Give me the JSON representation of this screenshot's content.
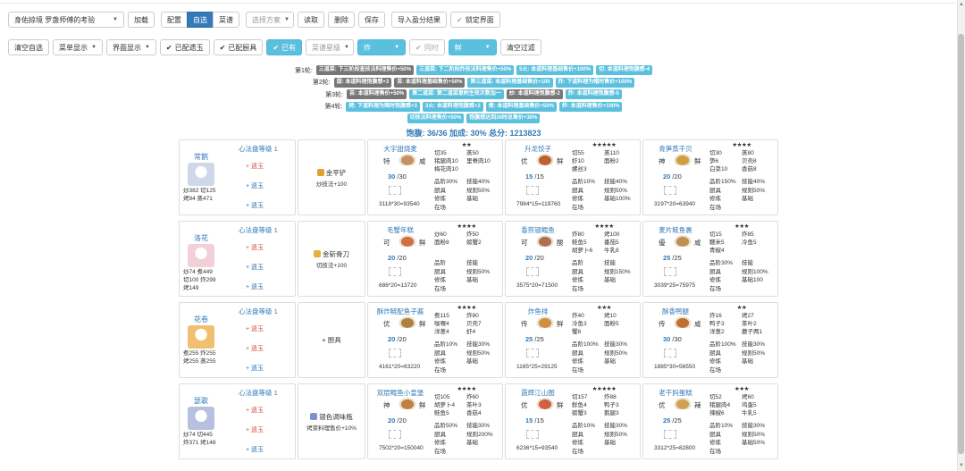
{
  "toolbar": {
    "rule_select": "身佑掠境 罗盏师傅的考验",
    "load": "加载",
    "config": "配置",
    "selfselect": "自选",
    "chef_select": "菜谱",
    "choose_plan": "选择方案",
    "read": "读取",
    "delete": "删除",
    "save": "保存",
    "import_result": "导入盈分结果",
    "lock_ui": "锁定界面"
  },
  "filterbar": {
    "clear_select": "清空自选",
    "menu_show": "菜单显示",
    "ui_show": "界面显示",
    "equipped_items": "已配遗玉",
    "equipped_tools": "已配厨具",
    "owned": "已有",
    "rarity_placeholder": "菜谱星级",
    "fry": "炸",
    "same_time": "同时",
    "fresh": "鲜",
    "clear_filter": "清空过滤"
  },
  "buffs": [
    {
      "label": "第1轮:",
      "tags": [
        {
          "text": "三道菜: 下三阶段查技法料理售价+50%",
          "c": "gray"
        },
        {
          "text": "三道菜: 下二阶段炸技法料理售价+50%",
          "c": "cyan"
        },
        {
          "text": "5火: 本道料理基础售价+100%",
          "c": "cyan"
        },
        {
          "text": "切: 本道料理饱腹感-4",
          "c": "cyan"
        }
      ]
    },
    {
      "label": "第2轮:",
      "tags": [
        {
          "text": "甜: 本道料理饱腹感+3",
          "c": "gray"
        },
        {
          "text": "苦: 本道料理基础售价+50%",
          "c": "gray"
        },
        {
          "text": "第三道菜: 本道料理基础售价+100",
          "c": "cyan"
        },
        {
          "text": "炸: 下道料理为帽时售价+100%",
          "c": "cyan"
        }
      ]
    },
    {
      "label": "第3轮:",
      "tags": [
        {
          "text": "苦: 本道料理售价+50%",
          "c": "gray"
        },
        {
          "text": "第二道菜: 第二道菜意附生效次数加一",
          "c": "cyan"
        },
        {
          "text": "炒: 本道料理饱腹感-2",
          "c": "gray"
        },
        {
          "text": "炸: 本道料理饱腹感-5",
          "c": "cyan"
        }
      ]
    },
    {
      "label": "第4轮:",
      "tags": [
        {
          "text": "烤: 下道料理为辣时饱腹感+3",
          "c": "cyan"
        },
        {
          "text": "3火: 本道料理饱腹感+2",
          "c": "cyan"
        },
        {
          "text": "煮: 本道料理基础售价+50%",
          "c": "cyan"
        },
        {
          "text": "炸: 本道料理售价+100%",
          "c": "cyan"
        }
      ]
    },
    {
      "label": "",
      "tags": [
        {
          "text": "切技法料理售价+50%",
          "c": "cyan"
        },
        {
          "text": "饱腹感达到36时总售价+30%",
          "c": "cyan"
        }
      ]
    }
  ],
  "summary": "饱腹: 36/36 加成: 30% 总分: 1213823",
  "rows": [
    {
      "chef": {
        "name": "常鹅",
        "level": "心法盘等级 1",
        "stats": [
          "炒382 切125",
          "烤94  蒸471"
        ],
        "av": "#cfd8e8",
        "axes": [
          {
            "t": "+ 遗玉",
            "c": "r"
          },
          {
            "t": "+ 遗玉",
            "c": "b"
          },
          {
            "t": "+ 遗玉",
            "c": "b"
          }
        ]
      },
      "equip": {
        "name": "金平铲",
        "sub": "炒技法+100",
        "ic": "#e0a030"
      },
      "dishes": [
        {
          "name": "大宇甜烧麦",
          "stars": "★★",
          "rank": "特",
          "flavor": "咸",
          "fc": "#c89060",
          "qty": "30",
          "qmax": "/30",
          "formula": "3118*30=93540",
          "ings": [
            "切35",
            "蒸50",
            "猪腿肉10",
            "里脊肉10",
            "梅花肉10",
            ""
          ],
          "det": [
            "品阶30%",
            "技能40%",
            "厨具",
            "规则50%",
            "修炼",
            "基础",
            "在场",
            ""
          ]
        },
        {
          "name": "升龙饺子",
          "stars": "★★★★★",
          "rank": "优",
          "flavor": "鲜",
          "fc": "#c06030",
          "qty": "15",
          "qmax": "/15",
          "formula": "7984*15=119760",
          "ings": [
            "切55",
            "蒸110",
            "虾10",
            "面粉2",
            "螺丝3",
            ""
          ],
          "det": [
            "品阶10%",
            "技能40%",
            "厨具",
            "规则50%",
            "修炼",
            "基础100%",
            "在场",
            ""
          ]
        },
        {
          "name": "青笋蒸干贝",
          "stars": "★★★★",
          "rank": "神",
          "flavor": "鲜",
          "fc": "#d0a040",
          "qty": "20",
          "qmax": "/20",
          "formula": "3197*20=63940",
          "ings": [
            "切30",
            "蒸80",
            "笋6",
            "贝壳8",
            "白菜10",
            "香菇8"
          ],
          "det": [
            "品阶150%",
            "技能40%",
            "厨具",
            "规则50%",
            "修炼",
            "基础",
            "在场",
            ""
          ]
        }
      ]
    },
    {
      "chef": {
        "name": "洛花",
        "level": "心法盘等级 1",
        "stats": [
          "炒74  煮449",
          "切100 炸299",
          "烤149"
        ],
        "av": "#f3d0d8",
        "axes": [
          {
            "t": "+ 遗玉",
            "c": "r"
          },
          {
            "t": "+ 遗玉",
            "c": "b"
          },
          {
            "t": "+ 遗玉",
            "c": "b"
          }
        ]
      },
      "equip": {
        "name": "金斩骨刀",
        "sub": "切技法+100",
        "ic": "#e8b040"
      },
      "dishes": [
        {
          "name": "毛蟹年糕",
          "stars": "★★★★",
          "rank": "可",
          "flavor": "鲜",
          "fc": "#d07040",
          "qty": "20",
          "qmax": "/20",
          "formula": "686*20=13720",
          "ings": [
            "炒60",
            "炸50",
            "面粉8",
            "螃蟹2",
            "",
            ""
          ],
          "det": [
            "品阶",
            "技能",
            "厨具",
            "规则50%",
            "修炼",
            "基础",
            "在场",
            ""
          ]
        },
        {
          "name": "香煎银鳕鱼",
          "stars": "★★★★",
          "rank": "可",
          "flavor": "酸",
          "fc": "#b07050",
          "qty": "20",
          "qmax": "/20",
          "formula": "3575*20=71500",
          "ings": [
            "炸80",
            "烤100",
            "鲑鱼5",
            "番茄5",
            "胡萝卜6",
            "牛乳8"
          ],
          "det": [
            "品阶",
            "技能",
            "厨具",
            "规则150%",
            "修炼",
            "基础",
            "在场",
            ""
          ]
        },
        {
          "name": "麦片鲑鱼裹",
          "stars": "★★★",
          "rank": "優",
          "flavor": "咸",
          "fc": "#c09050",
          "qty": "25",
          "qmax": "/25",
          "formula": "3039*25=75975",
          "ings": [
            "切15",
            "炸85",
            "糯米5",
            "冷鱼5",
            "青椒4",
            ""
          ],
          "det": [
            "品阶30%",
            "技能",
            "厨具",
            "规则100%",
            "修炼",
            "基础100",
            "在场",
            ""
          ]
        }
      ]
    },
    {
      "chef": {
        "name": "花卷",
        "level": "心法盘等级 1",
        "stats": [
          "煮255 炸255",
          "烤255 蒸255"
        ],
        "av": "#f0c070",
        "axes": [
          {
            "t": "+ 遗玉",
            "c": "r"
          },
          {
            "t": "+ 遗玉",
            "c": "r"
          },
          {
            "t": "+ 遗玉",
            "c": "b"
          }
        ]
      },
      "equip": {
        "name": "+ 厨具",
        "sub": "",
        "ic": ""
      },
      "dishes": [
        {
          "name": "酥炸鲢配鱼子酱",
          "stars": "★★★★",
          "rank": "优",
          "flavor": "鲜",
          "fc": "#b08040",
          "qty": "20",
          "qmax": "/20",
          "formula": "4161*20=83220",
          "ings": [
            "煮115",
            "炸80",
            "咖喱4",
            "贝壳7",
            "洋葱4",
            "虾4"
          ],
          "det": [
            "品阶10%",
            "技能30%",
            "厨具",
            "规则50%",
            "修炼",
            "基础",
            "在场",
            ""
          ]
        },
        {
          "name": "炸鱼排",
          "stars": "★★★",
          "rank": "传",
          "flavor": "鲜",
          "fc": "#d09040",
          "qty": "25",
          "qmax": "/25",
          "formula": "1165*25=29125",
          "ings": [
            "炸40",
            "烤10",
            "冷鱼3",
            "面粉5",
            "蟹8",
            ""
          ],
          "det": [
            "品阶100%",
            "技能30%",
            "厨具",
            "规则50%",
            "修炼",
            "基础",
            "在场",
            ""
          ]
        },
        {
          "name": "酥香鸭腿",
          "stars": "★★",
          "rank": "传",
          "flavor": "咸",
          "fc": "#c07030",
          "qty": "30",
          "qmax": "/30",
          "formula": "1885*30=56550",
          "ings": [
            "炸16",
            "烤27",
            "鸭子3",
            "茶叶2",
            "洋葱2",
            "蘑子两1"
          ],
          "det": [
            "品阶100%",
            "技能30%",
            "厨具",
            "规则50%",
            "修炼",
            "基础",
            "在场",
            ""
          ]
        }
      ]
    },
    {
      "chef": {
        "name": "瑟歌",
        "level": "心法盘等级 1",
        "stats": [
          "炒74  切445",
          "炸371 烤148"
        ],
        "av": "#b8c0e0",
        "axes": [
          {
            "t": "+ 遗玉",
            "c": "r"
          },
          {
            "t": "+ 遗玉",
            "c": "r"
          },
          {
            "t": "+ 遗玉",
            "c": "b"
          }
        ]
      },
      "equip": {
        "name": "银色调味瓶",
        "sub": "烤菜料理售价+10%",
        "ic": "#8090d0"
      },
      "dishes": [
        {
          "name": "双层鳕鱼小皇堡",
          "stars": "★★★★",
          "rank": "神",
          "flavor": "鲜",
          "fc": "#c08040",
          "qty": "20",
          "qmax": "/20",
          "formula": "7502*20=150040",
          "ings": [
            "切105",
            "炸60",
            "胡萝卜4",
            "茶叶3",
            "鲑鱼5",
            "香菇4"
          ],
          "det": [
            "品阶50%",
            "技能30%",
            "厨具",
            "规则200%",
            "修炼",
            "基础",
            "在场",
            ""
          ]
        },
        {
          "name": "霞辉江山图",
          "stars": "★★★★★",
          "rank": "优",
          "flavor": "鲜",
          "fc": "#d06040",
          "qty": "15",
          "qmax": "/15",
          "formula": "6236*15=93540",
          "ings": [
            "切157",
            "炸88",
            "鲜鱼4",
            "鸭子3",
            "螃蟹3",
            "鹅腿3"
          ],
          "det": [
            "品阶10%",
            "技能30%",
            "厨具",
            "规则50%",
            "修炼",
            "基础",
            "在场",
            ""
          ]
        },
        {
          "name": "老干妈蛋糕",
          "stars": "★★★",
          "rank": "优",
          "flavor": "辣",
          "fc": "#d0a050",
          "qty": "25",
          "qmax": "/25",
          "formula": "3312*25=82800",
          "ings": [
            "切52",
            "烤60",
            "猪腿肉4",
            "鸡蛋5",
            "辣椒6",
            "牛乳5"
          ],
          "det": [
            "品阶10%",
            "技能30%",
            "厨具",
            "规则50%",
            "修炼",
            "基础50%",
            "在场",
            ""
          ]
        }
      ]
    }
  ]
}
